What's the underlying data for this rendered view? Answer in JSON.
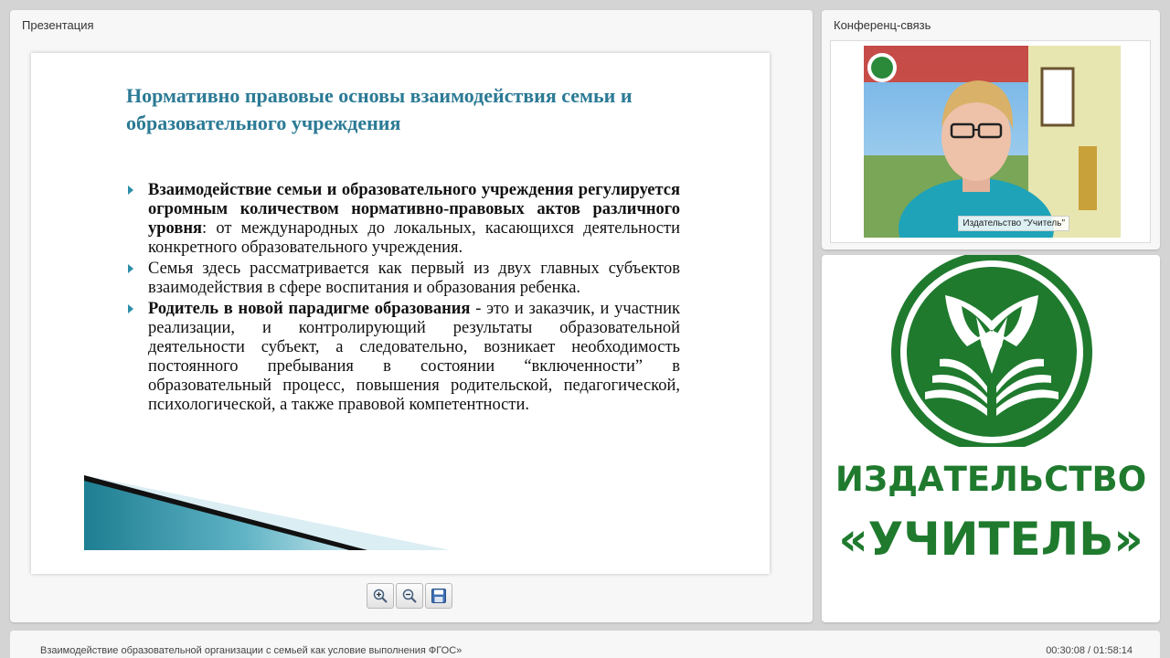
{
  "presentation": {
    "panel_title": "Презентация",
    "slide": {
      "title": "Нормативно правовые основы взаимодействия семьи и  образовательного учреждения",
      "bullets": [
        {
          "bold": "Взаимодействие семьи и образовательного учреждения регулируется огромным количеством нормативно-правовых актов различного уровня",
          "text": ": от международных до локальных, касающихся деятельности конкретного образовательного учреждения."
        },
        {
          "bold": "",
          "text": "Семья здесь рассматривается как первый из двух главных субъектов взаимодействия в сфере воспитания и образования ребенка."
        },
        {
          "bold": "Родитель в новой парадигме образования",
          "text": " - это и заказчик,  и участник реализации, и контролирующий результаты образовательной деятельности субъект, а следовательно, возникает необходимость постоянного пребывания в состоянии “включенности” в образовательный процесс, повышения родительской, педагогической, психологической, а также правовой компетентности."
        }
      ]
    },
    "toolbar": {
      "zoom_in_icon": "zoom-in-icon",
      "zoom_out_icon": "zoom-out-icon",
      "save_icon": "save-icon"
    }
  },
  "conference": {
    "panel_title": "Конференц-связь",
    "video_label": "Издательство \"Учитель\""
  },
  "logo": {
    "line1": "ИЗДАТЕЛЬСТВО",
    "line2": "«УЧИТЕЛЬ»",
    "color": "#1f7a2e"
  },
  "footer": {
    "title": "Взаимодействие образовательной организации с семьей как условие выполнения ФГОС»",
    "time": "00:30:08 / 01:58:14"
  }
}
